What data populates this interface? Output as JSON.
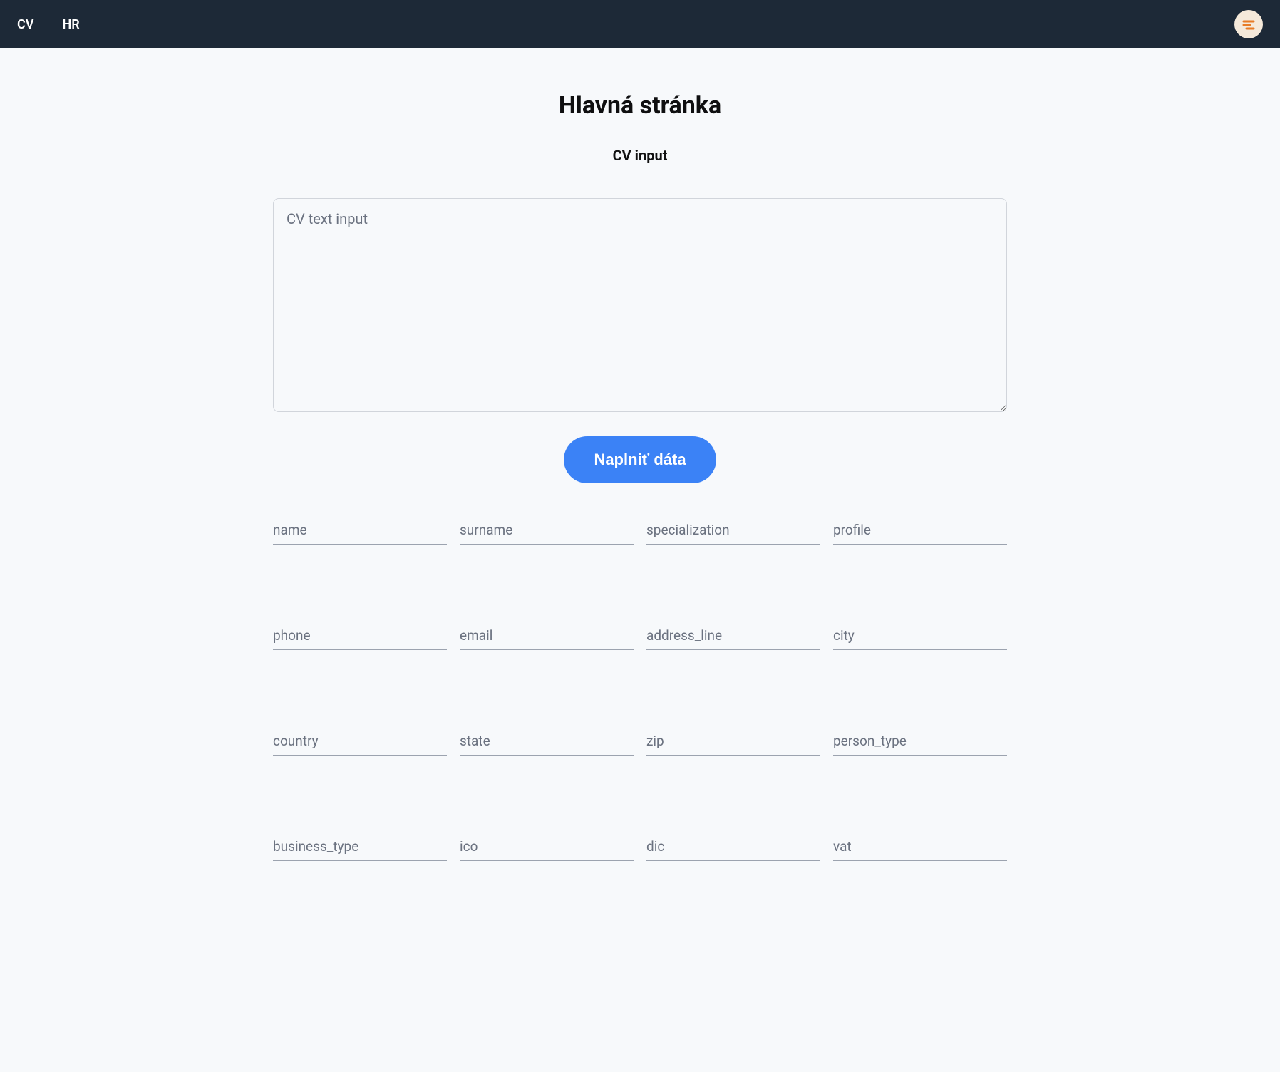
{
  "nav": {
    "links": [
      "CV",
      "HR"
    ]
  },
  "page": {
    "title": "Hlavná stránka",
    "subtitle": "CV input",
    "textarea_placeholder": "CV text input",
    "button_label": "Naplniť dáta"
  },
  "fields": {
    "row1": [
      "name",
      "surname",
      "specialization",
      "profile"
    ],
    "row2": [
      "phone",
      "email",
      "address_line",
      "city"
    ],
    "row3": [
      "country",
      "state",
      "zip",
      "person_type"
    ],
    "row4": [
      "business_type",
      "ico",
      "dic",
      "vat"
    ]
  }
}
